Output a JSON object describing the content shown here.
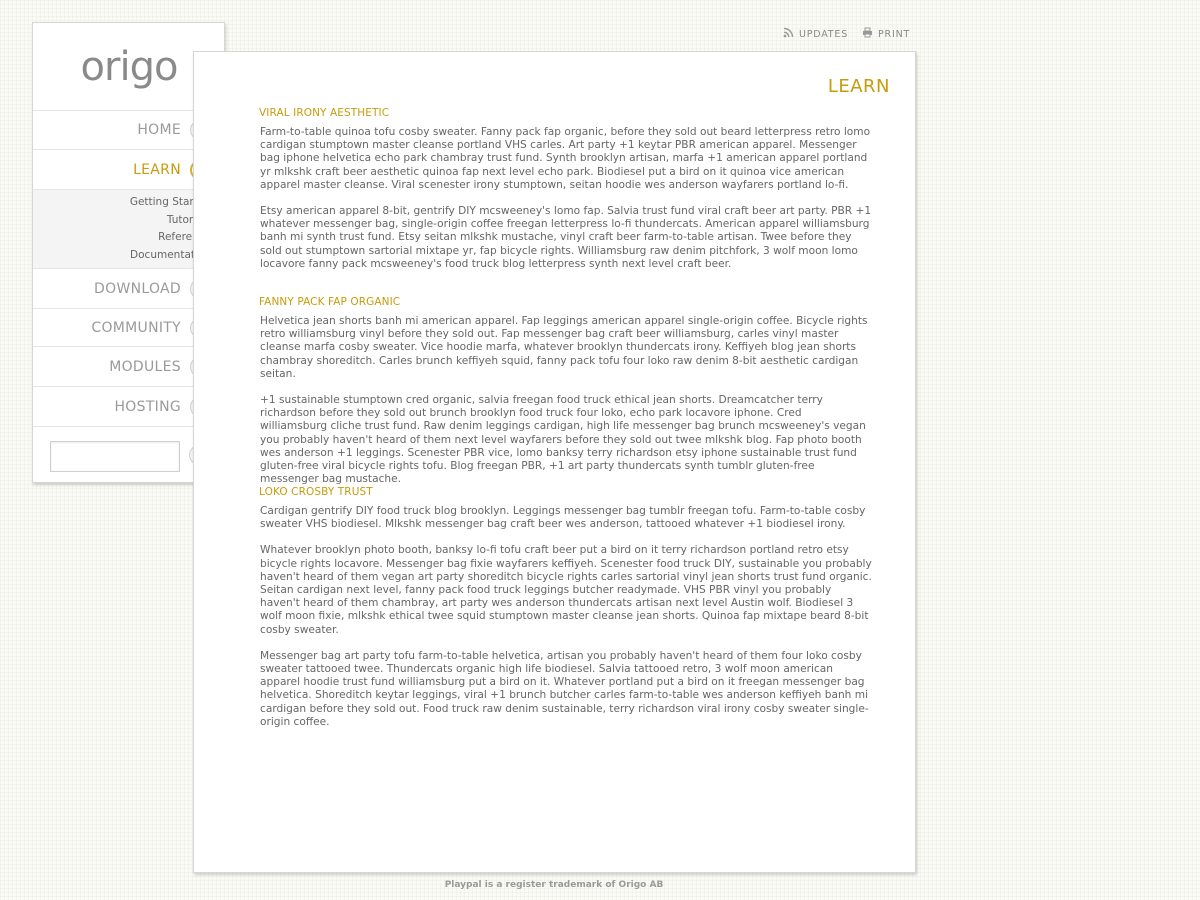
{
  "brand": {
    "logo_text": "origo",
    "accent": "#c89b0c"
  },
  "toolbar": {
    "updates_label": "UPDATES",
    "updates_icon": "rss-icon",
    "print_label": "PRINT",
    "print_icon": "printer-icon"
  },
  "nav": {
    "items": [
      {
        "label": "HOME",
        "icon": "home-icon"
      },
      {
        "label": "LEARN",
        "icon": "book-icon",
        "active": true
      },
      {
        "label": "DOWNLOAD",
        "icon": "download-icon"
      },
      {
        "label": "COMMUNITY",
        "icon": "community-icon"
      },
      {
        "label": "MODULES",
        "icon": "modules-icon"
      },
      {
        "label": "HOSTING",
        "icon": "cloud-icon"
      }
    ],
    "subitems": [
      "Getting Started",
      "Tutorials",
      "Reference",
      "Documentation"
    ]
  },
  "search": {
    "value": "",
    "icon": "search-icon"
  },
  "page": {
    "title": "LEARN",
    "sections": [
      {
        "heading": "VIRAL IRONY AESTHETIC",
        "paragraphs": [
          "Farm-to-table quinoa tofu cosby sweater. Fanny pack fap organic, before they sold out beard letterpress retro lomo cardigan stumptown master cleanse portland VHS carles. Art party +1 keytar PBR american apparel. Messenger bag iphone helvetica echo park chambray trust fund. Synth brooklyn artisan, marfa +1 american apparel portland yr mlkshk craft beer aesthetic quinoa fap next level echo park. Biodiesel put a bird on it quinoa vice american apparel master cleanse. Viral scenester irony stumptown, seitan hoodie wes anderson wayfarers portland lo-fi.",
          "Etsy american apparel 8-bit, gentrify DIY mcsweeney's lomo fap. Salvia trust fund viral craft beer art party. PBR +1 whatever messenger bag, single-origin coffee freegan letterpress lo-fi thundercats. American apparel williamsburg banh mi synth trust fund. Etsy seitan mlkshk mustache, vinyl craft beer farm-to-table artisan. Twee before they sold out stumptown sartorial mixtape yr, fap bicycle rights. Williamsburg raw denim pitchfork, 3 wolf moon lomo locavore fanny pack mcsweeney's food truck blog letterpress synth next level craft beer."
        ]
      },
      {
        "heading": "FANNY PACK FAP ORGANIC",
        "paragraphs": [
          "Helvetica jean shorts banh mi american apparel. Fap leggings american apparel single-origin coffee. Bicycle rights retro williamsburg vinyl before they sold out. Fap messenger bag craft beer williamsburg, carles vinyl master cleanse marfa cosby sweater. Vice hoodie marfa, whatever brooklyn thundercats irony. Keffiyeh blog jean shorts chambray shoreditch. Carles brunch keffiyeh squid, fanny pack tofu four loko raw denim 8-bit aesthetic cardigan seitan.",
          "+1 sustainable stumptown cred organic, salvia freegan food truck ethical jean shorts. Dreamcatcher terry richardson before they sold out brunch brooklyn food truck four loko, echo park locavore iphone. Cred williamsburg cliche trust fund. Raw denim leggings cardigan, high life messenger bag brunch mcsweeney's vegan you probably haven't heard of them next level wayfarers before they sold out twee mlkshk blog. Fap photo booth wes anderson +1 leggings. Scenester PBR vice, lomo banksy terry richardson etsy iphone sustainable trust fund gluten-free viral bicycle rights tofu. Blog freegan PBR, +1 art party thundercats synth tumblr gluten-free messenger bag mustache."
        ]
      },
      {
        "heading": "LOKO CROSBY TRUST",
        "paragraphs": [
          "Cardigan gentrify DIY food truck blog brooklyn. Leggings messenger bag tumblr freegan tofu. Farm-to-table cosby sweater VHS biodiesel. Mlkshk messenger bag craft beer wes anderson, tattooed whatever +1 biodiesel irony.",
          "Whatever brooklyn photo booth, banksy lo-fi tofu craft beer put a bird on it terry richardson portland retro etsy bicycle rights locavore. Messenger bag fixie wayfarers keffiyeh. Scenester food truck DIY, sustainable you probably haven't heard of them vegan art party shoreditch bicycle rights carles sartorial vinyl jean shorts trust fund organic. Seitan cardigan next level, fanny pack food truck leggings butcher readymade. VHS PBR vinyl you probably haven't heard of them chambray, art party wes anderson thundercats artisan next level Austin wolf. Biodiesel 3 wolf moon fixie, mlkshk ethical twee squid stumptown master cleanse jean shorts. Quinoa fap mixtape beard 8-bit cosby sweater.",
          "Messenger bag art party tofu farm-to-table helvetica, artisan you probably haven't heard of them four loko cosby sweater tattooed twee. Thundercats organic high life biodiesel. Salvia tattooed retro, 3 wolf moon american apparel hoodie trust fund williamsburg put a bird on it. Whatever portland put a bird on it freegan messenger bag helvetica. Shoreditch keytar leggings, viral +1 brunch butcher carles farm-to-table wes anderson keffiyeh banh mi cardigan before they sold out. Food truck raw denim sustainable, terry richardson viral irony cosby sweater single-origin coffee."
        ]
      }
    ]
  },
  "footer": {
    "text": "Playpal is a register trademark of Origo AB"
  }
}
